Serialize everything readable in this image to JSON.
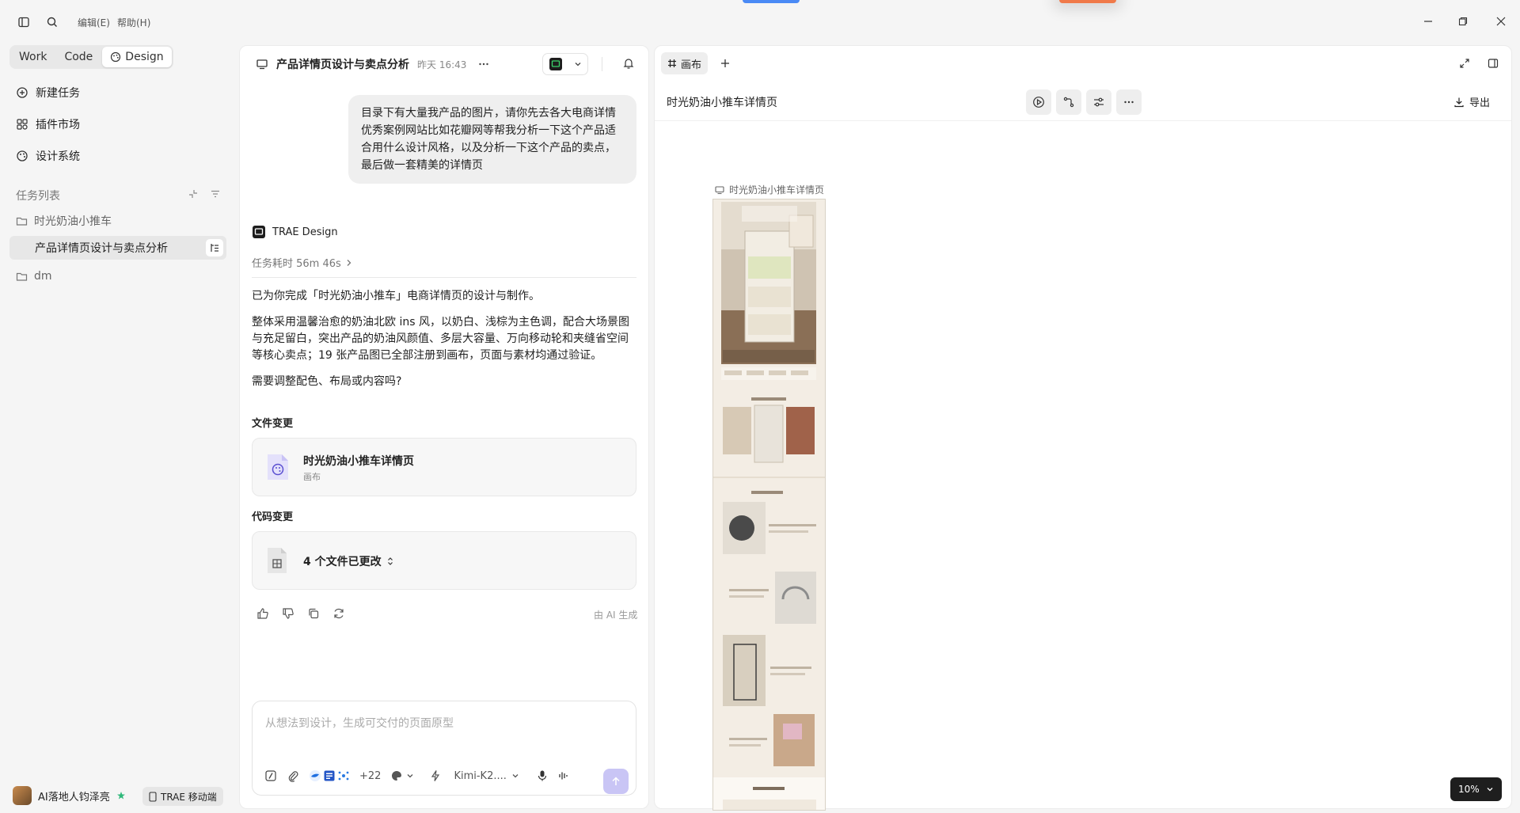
{
  "menu": {
    "edit": "编辑(E)",
    "help": "帮助(H)"
  },
  "modes": {
    "work": "Work",
    "code": "Code",
    "design": "Design"
  },
  "nav": {
    "new_task": "新建任务",
    "plugins": "插件市场",
    "design_system": "设计系统"
  },
  "tasks": {
    "title": "任务列表",
    "items": [
      {
        "label": "时光奶油小推车"
      },
      {
        "label": "产品详情页设计与卖点分析"
      },
      {
        "label": "dm"
      }
    ]
  },
  "user": {
    "name": "AI落地人钧泽亮",
    "mobile": "TRAE 移动端"
  },
  "chat": {
    "title": "产品详情页设计与卖点分析",
    "time": "昨天 16:43",
    "user_message": "目录下有大量我产品的图片，请你先去各大电商详情优秀案例网站比如花瓣网等帮我分析一下这个产品适合用什么设计风格，以及分析一下这个产品的卖点，最后做一套精美的详情页",
    "agent_name": "TRAE Design",
    "duration": "任务耗时 56m 46s",
    "para1": "已为你完成「时光奶油小推车」电商详情页的设计与制作。",
    "para2": "整体采用温馨治愈的奶油北欧 ins 风，以奶白、浅棕为主色调，配合大场景图与充足留白，突出产品的奶油风颜值、多层大容量、万向移动轮和夹缝省空间等核心卖点；19 张产品图已全部注册到画布，页面与素材均通过验证。",
    "para3": "需要调整配色、布局或内容吗?",
    "file_changes_label": "文件变更",
    "file_card": {
      "title": "时光奶油小推车详情页",
      "sub": "画布"
    },
    "code_changes_label": "代码变更",
    "code_card": {
      "title": "4 个文件已更改"
    },
    "ai_note": "由 AI 生成",
    "composer_placeholder": "从想法到设计，生成可交付的页面原型",
    "plus_count": "+22",
    "model": "Kimi-K2...."
  },
  "canvas": {
    "tab": "画布",
    "title": "时光奶油小推车详情页",
    "export": "导出",
    "frame_label": "时光奶油小推车详情页",
    "zoom": "10%"
  }
}
